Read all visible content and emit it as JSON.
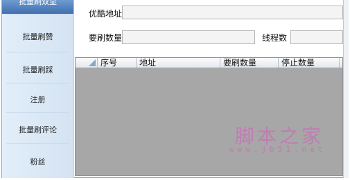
{
  "sidebar": {
    "items": [
      {
        "label": "批量刷双显"
      },
      {
        "label": "批量刷赞"
      },
      {
        "label": "批量刷踩"
      },
      {
        "label": "注册"
      },
      {
        "label": "批量刷评论"
      },
      {
        "label": "粉丝"
      }
    ]
  },
  "form": {
    "url_label": "优酷地址",
    "url_value": "",
    "count_label": "要刷数量",
    "count_value": "",
    "threads_label": "线程数",
    "threads_value": ""
  },
  "grid": {
    "columns": [
      "序号",
      "地址",
      "要刷数量",
      "停止数量"
    ],
    "rows": []
  },
  "watermark": {
    "title": "脚本之家",
    "url": "www.jb51.net"
  },
  "colors": {
    "sidebar_bg": "#dde9f6",
    "active_tab": "#4a7bb9",
    "grid_bg": "#a7a7a7",
    "watermark": "#c86fb6"
  }
}
